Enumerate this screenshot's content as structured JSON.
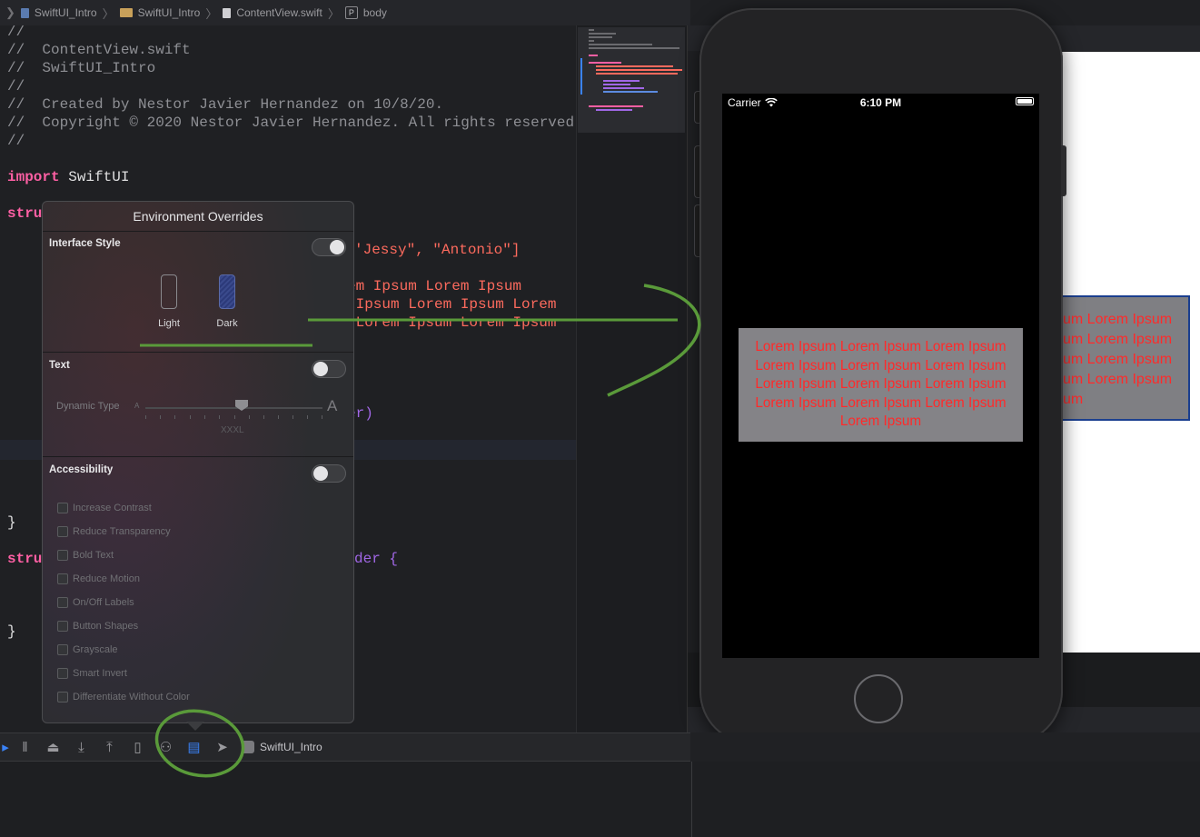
{
  "breadcrumb": {
    "items": [
      "SwiftUI_Intro",
      "SwiftUI_Intro",
      "ContentView.swift",
      "body"
    ],
    "icons": [
      "swift-file-icon",
      "folder-icon",
      "swift-file-icon",
      "property-icon"
    ]
  },
  "code": {
    "l1": "//",
    "l2": "//  ContentView.swift",
    "l3": "//  SwiftUI_Intro",
    "l4": "//",
    "l5": "//  Created by Nestor Javier Hernandez on 10/8/20.",
    "l6": "//  Copyright © 2020 Nestor Javier Hernandez. All rights reserved.",
    "l7": "//",
    "import_kw": "import",
    "import_mod": "SwiftUI",
    "struct_kw_1": "stru",
    "names_tail": "'Jessy\", \"Antonio\"]",
    "lorem_1": "em Ipsum Lorem Ipsum",
    "lorem_2": " Ipsum Lorem Ipsum Lorem",
    "lorem_3": " Lorem Ipsum Lorem Ipsum",
    "border_tail": "er)",
    "paren_tail": ")",
    "close_brace_1": "}",
    "struct_kw_2": "stru",
    "provider_tail": "der {",
    "close_brace_2": "}"
  },
  "popover": {
    "title": "Environment Overrides",
    "interface_style": {
      "title": "Interface Style",
      "enabled": true,
      "light_label": "Light",
      "dark_label": "Dark"
    },
    "text": {
      "title": "Text",
      "enabled": false,
      "dynamic_type_label": "Dynamic Type",
      "small_a": "A",
      "large_a": "A",
      "value": "XXXL"
    },
    "accessibility": {
      "title": "Accessibility",
      "enabled": false,
      "options": [
        "Increase Contrast",
        "Reduce Transparency",
        "Bold Text",
        "Reduce Motion",
        "On/Off Labels",
        "Button Shapes",
        "Grayscale",
        "Smart Invert",
        "Differentiate Without Color"
      ]
    }
  },
  "simulator": {
    "carrier": "Carrier",
    "time": "6:10 PM",
    "lorem_text": "Lorem Ipsum Lorem Ipsum Lorem Ipsum Lorem Ipsum Lorem Ipsum Lorem Ipsum Lorem Ipsum Lorem Ipsum Lorem Ipsum Lorem Ipsum Lorem Ipsum Lorem Ipsum Lorem Ipsum"
  },
  "preview": {
    "lines": [
      "um Lorem Ipsum",
      "um Lorem Ipsum",
      "um Lorem Ipsum",
      "um Lorem Ipsum",
      "um"
    ]
  },
  "toolbar": {
    "scheme": "SwiftUI_Intro",
    "icons": [
      "breakpoint-icon",
      "pause-icon",
      "step-over-icon",
      "step-into-icon",
      "step-out-icon",
      "view-debugger-icon",
      "memory-graph-icon",
      "environment-overrides-icon",
      "location-icon"
    ]
  },
  "colors": {
    "annotation": "#5a9a3a",
    "lorem_red": "#ff2a2a",
    "accent": "#3a82f6"
  }
}
